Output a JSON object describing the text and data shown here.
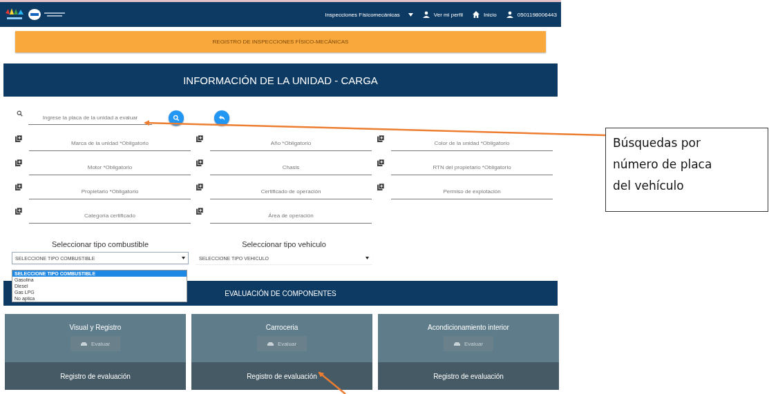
{
  "header": {
    "menu": {
      "label": "Inspecciones Físicomecánicas"
    },
    "profile_link": "Ver mi perfil",
    "home_link": "Inicio",
    "user_id": "0501198006443"
  },
  "banner": "REGISTRO DE INSPECCIONES FÍSICO-MECÁNICAS",
  "title": "INFORMACIÓN DE LA UNIDAD - CARGA",
  "search": {
    "placeholder": "Ingrese la placa de la unidad a evaluar"
  },
  "fields": [
    {
      "placeholder": "Marca de la unidad *Obligatorio"
    },
    {
      "placeholder": "Año *Obligatorio"
    },
    {
      "placeholder": "Color de la unidad *Obligatorio"
    },
    {
      "placeholder": "Motor *Obligatorio"
    },
    {
      "placeholder": "Chasis"
    },
    {
      "placeholder": "RTN del propietario *Obligatorio"
    },
    {
      "placeholder": "Propietario *Obligatorio"
    },
    {
      "placeholder": "Certificado de operación"
    },
    {
      "placeholder": "Permiso de explotación"
    },
    {
      "placeholder": "Categoría certificado"
    },
    {
      "placeholder": "Área de operación"
    }
  ],
  "selects": [
    {
      "label": "Seleccionar tipo combustible",
      "value": "SELECCIONE TIPO COMBUSTIBLE",
      "open": true,
      "options": [
        {
          "label": "SELECCIONE TIPO COMBUSTIBLE",
          "selected": true
        },
        {
          "label": "Gasolina",
          "selected": false
        },
        {
          "label": "Diesel",
          "selected": false
        },
        {
          "label": "Gas LPG",
          "selected": false
        },
        {
          "label": "No aplica",
          "selected": false
        }
      ]
    },
    {
      "label": "Seleccionar tipo vehiculo",
      "value": "SELECCIONE TIPO VEHICULO",
      "open": false
    }
  ],
  "section_title": "EVALUACIÓN DE COMPONENTES",
  "cards": [
    {
      "title": "Visual y Registro",
      "button": {
        "label": "Evaluar",
        "disabled": true
      },
      "footer": "Registro de evaluación"
    },
    {
      "title": "Carroceria",
      "button": {
        "label": "Evaluar",
        "disabled": true
      },
      "footer": "Registro de evaluación"
    },
    {
      "title": "Acondicionamiento interior",
      "button": {
        "label": "Evaluar",
        "disabled": true
      },
      "footer": "Registro de evaluación"
    }
  ],
  "callout": "Búsquedas por número de placa del vehículo"
}
